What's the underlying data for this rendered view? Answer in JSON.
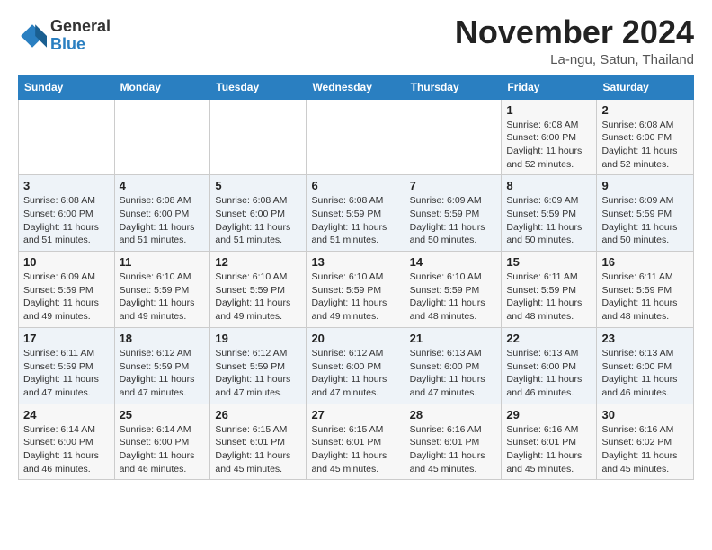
{
  "logo": {
    "general": "General",
    "blue": "Blue"
  },
  "header": {
    "month": "November 2024",
    "location": "La-ngu, Satun, Thailand"
  },
  "weekdays": [
    "Sunday",
    "Monday",
    "Tuesday",
    "Wednesday",
    "Thursday",
    "Friday",
    "Saturday"
  ],
  "weeks": [
    [
      {
        "day": "",
        "info": ""
      },
      {
        "day": "",
        "info": ""
      },
      {
        "day": "",
        "info": ""
      },
      {
        "day": "",
        "info": ""
      },
      {
        "day": "",
        "info": ""
      },
      {
        "day": "1",
        "info": "Sunrise: 6:08 AM\nSunset: 6:00 PM\nDaylight: 11 hours\nand 52 minutes."
      },
      {
        "day": "2",
        "info": "Sunrise: 6:08 AM\nSunset: 6:00 PM\nDaylight: 11 hours\nand 52 minutes."
      }
    ],
    [
      {
        "day": "3",
        "info": "Sunrise: 6:08 AM\nSunset: 6:00 PM\nDaylight: 11 hours\nand 51 minutes."
      },
      {
        "day": "4",
        "info": "Sunrise: 6:08 AM\nSunset: 6:00 PM\nDaylight: 11 hours\nand 51 minutes."
      },
      {
        "day": "5",
        "info": "Sunrise: 6:08 AM\nSunset: 6:00 PM\nDaylight: 11 hours\nand 51 minutes."
      },
      {
        "day": "6",
        "info": "Sunrise: 6:08 AM\nSunset: 5:59 PM\nDaylight: 11 hours\nand 51 minutes."
      },
      {
        "day": "7",
        "info": "Sunrise: 6:09 AM\nSunset: 5:59 PM\nDaylight: 11 hours\nand 50 minutes."
      },
      {
        "day": "8",
        "info": "Sunrise: 6:09 AM\nSunset: 5:59 PM\nDaylight: 11 hours\nand 50 minutes."
      },
      {
        "day": "9",
        "info": "Sunrise: 6:09 AM\nSunset: 5:59 PM\nDaylight: 11 hours\nand 50 minutes."
      }
    ],
    [
      {
        "day": "10",
        "info": "Sunrise: 6:09 AM\nSunset: 5:59 PM\nDaylight: 11 hours\nand 49 minutes."
      },
      {
        "day": "11",
        "info": "Sunrise: 6:10 AM\nSunset: 5:59 PM\nDaylight: 11 hours\nand 49 minutes."
      },
      {
        "day": "12",
        "info": "Sunrise: 6:10 AM\nSunset: 5:59 PM\nDaylight: 11 hours\nand 49 minutes."
      },
      {
        "day": "13",
        "info": "Sunrise: 6:10 AM\nSunset: 5:59 PM\nDaylight: 11 hours\nand 49 minutes."
      },
      {
        "day": "14",
        "info": "Sunrise: 6:10 AM\nSunset: 5:59 PM\nDaylight: 11 hours\nand 48 minutes."
      },
      {
        "day": "15",
        "info": "Sunrise: 6:11 AM\nSunset: 5:59 PM\nDaylight: 11 hours\nand 48 minutes."
      },
      {
        "day": "16",
        "info": "Sunrise: 6:11 AM\nSunset: 5:59 PM\nDaylight: 11 hours\nand 48 minutes."
      }
    ],
    [
      {
        "day": "17",
        "info": "Sunrise: 6:11 AM\nSunset: 5:59 PM\nDaylight: 11 hours\nand 47 minutes."
      },
      {
        "day": "18",
        "info": "Sunrise: 6:12 AM\nSunset: 5:59 PM\nDaylight: 11 hours\nand 47 minutes."
      },
      {
        "day": "19",
        "info": "Sunrise: 6:12 AM\nSunset: 5:59 PM\nDaylight: 11 hours\nand 47 minutes."
      },
      {
        "day": "20",
        "info": "Sunrise: 6:12 AM\nSunset: 6:00 PM\nDaylight: 11 hours\nand 47 minutes."
      },
      {
        "day": "21",
        "info": "Sunrise: 6:13 AM\nSunset: 6:00 PM\nDaylight: 11 hours\nand 47 minutes."
      },
      {
        "day": "22",
        "info": "Sunrise: 6:13 AM\nSunset: 6:00 PM\nDaylight: 11 hours\nand 46 minutes."
      },
      {
        "day": "23",
        "info": "Sunrise: 6:13 AM\nSunset: 6:00 PM\nDaylight: 11 hours\nand 46 minutes."
      }
    ],
    [
      {
        "day": "24",
        "info": "Sunrise: 6:14 AM\nSunset: 6:00 PM\nDaylight: 11 hours\nand 46 minutes."
      },
      {
        "day": "25",
        "info": "Sunrise: 6:14 AM\nSunset: 6:00 PM\nDaylight: 11 hours\nand 46 minutes."
      },
      {
        "day": "26",
        "info": "Sunrise: 6:15 AM\nSunset: 6:01 PM\nDaylight: 11 hours\nand 45 minutes."
      },
      {
        "day": "27",
        "info": "Sunrise: 6:15 AM\nSunset: 6:01 PM\nDaylight: 11 hours\nand 45 minutes."
      },
      {
        "day": "28",
        "info": "Sunrise: 6:16 AM\nSunset: 6:01 PM\nDaylight: 11 hours\nand 45 minutes."
      },
      {
        "day": "29",
        "info": "Sunrise: 6:16 AM\nSunset: 6:01 PM\nDaylight: 11 hours\nand 45 minutes."
      },
      {
        "day": "30",
        "info": "Sunrise: 6:16 AM\nSunset: 6:02 PM\nDaylight: 11 hours\nand 45 minutes."
      }
    ]
  ]
}
